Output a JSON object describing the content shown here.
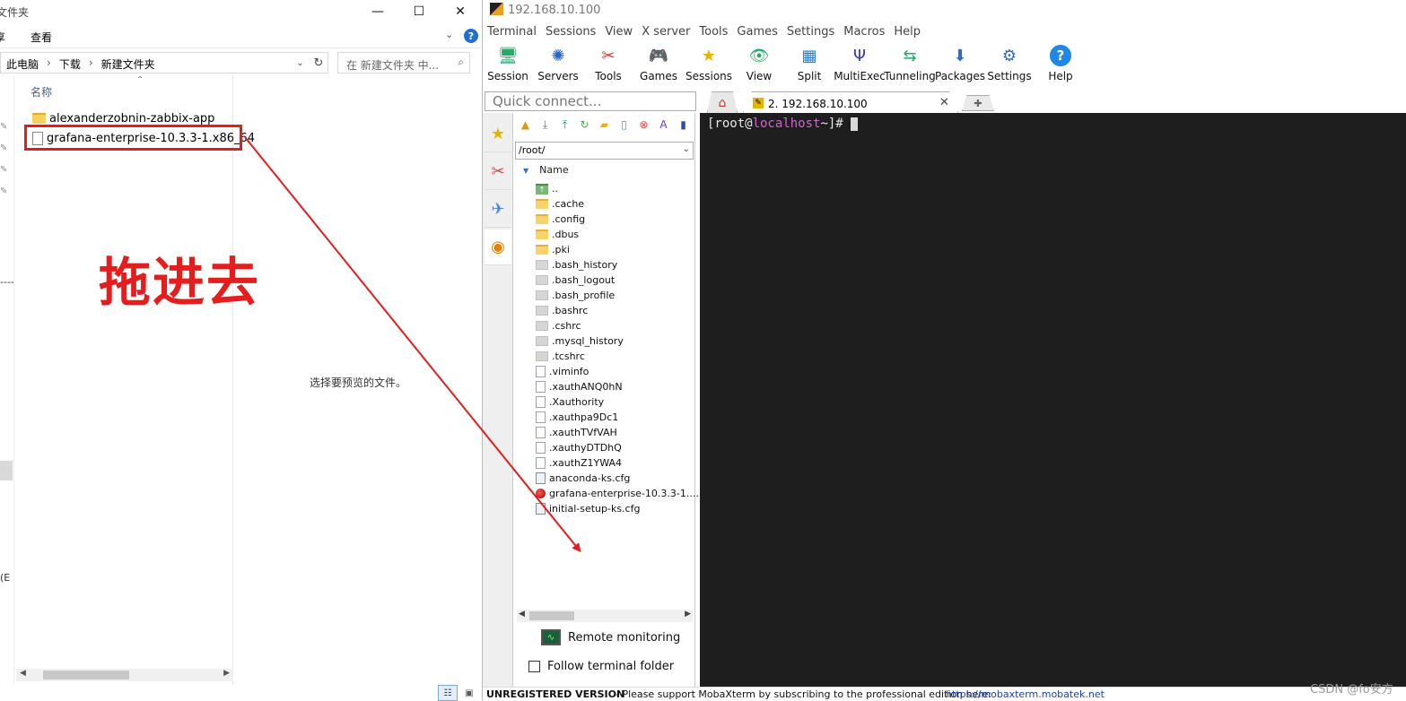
{
  "explorer": {
    "title": "文件夹",
    "ribbon": {
      "menu_1": "享",
      "menu_2": "查看"
    },
    "address": {
      "crumbs": [
        "此电脑",
        "下载",
        "新建文件夹"
      ]
    },
    "search_placeholder": "在 新建文件夹 中...",
    "column_name": "名称",
    "files": [
      {
        "name": "alexanderzobnin-zabbix-app",
        "kind": "folder"
      },
      {
        "name": "grafana-enterprise-10.3.3-1.x86_64",
        "kind": "file"
      }
    ],
    "preview_text": "选择要预览的文件。",
    "side_text": "(E",
    "dash_text": "----"
  },
  "annotation": {
    "drag_label": "拖进去",
    "color": "#e31c1c"
  },
  "moba": {
    "title": "192.168.10.100",
    "menu": [
      "Terminal",
      "Sessions",
      "View",
      "X server",
      "Tools",
      "Games",
      "Settings",
      "Macros",
      "Help"
    ],
    "toolbar": [
      {
        "label": "Session",
        "icon": "session-icon"
      },
      {
        "label": "Servers",
        "icon": "servers-icon"
      },
      {
        "label": "Tools",
        "icon": "tools-icon"
      },
      {
        "label": "Games",
        "icon": "games-icon"
      },
      {
        "label": "Sessions",
        "icon": "sessions-star-icon"
      },
      {
        "label": "View",
        "icon": "view-icon"
      },
      {
        "label": "Split",
        "icon": "split-icon"
      },
      {
        "label": "MultiExec",
        "icon": "multiexec-icon"
      },
      {
        "label": "Tunneling",
        "icon": "tunneling-icon"
      },
      {
        "label": "Packages",
        "icon": "packages-icon"
      },
      {
        "label": "Settings",
        "icon": "settings-icon"
      },
      {
        "label": "Help",
        "icon": "help-icon"
      }
    ],
    "quick_connect_placeholder": "Quick connect...",
    "active_tab": "2. 192.168.10.100",
    "sftp": {
      "path": "/root/",
      "column_name": "Name",
      "rows": [
        {
          "name": "..",
          "kind": "up"
        },
        {
          "name": ".cache",
          "kind": "folder"
        },
        {
          "name": ".config",
          "kind": "folder"
        },
        {
          "name": ".dbus",
          "kind": "folder"
        },
        {
          "name": ".pki",
          "kind": "folder"
        },
        {
          "name": ".bash_history",
          "kind": "hidden"
        },
        {
          "name": ".bash_logout",
          "kind": "hidden"
        },
        {
          "name": ".bash_profile",
          "kind": "hidden"
        },
        {
          "name": ".bashrc",
          "kind": "hidden"
        },
        {
          "name": ".cshrc",
          "kind": "hidden"
        },
        {
          "name": ".mysql_history",
          "kind": "hidden"
        },
        {
          "name": ".tcshrc",
          "kind": "hidden"
        },
        {
          "name": ".viminfo",
          "kind": "file"
        },
        {
          "name": ".xauthANQ0hN",
          "kind": "file"
        },
        {
          "name": ".Xauthority",
          "kind": "file"
        },
        {
          "name": ".xauthpa9Dc1",
          "kind": "file"
        },
        {
          "name": ".xauthTVfVAH",
          "kind": "file"
        },
        {
          "name": ".xauthyDTDhQ",
          "kind": "file"
        },
        {
          "name": ".xauthZ1YWA4",
          "kind": "file"
        },
        {
          "name": "anaconda-ks.cfg",
          "kind": "cfg"
        },
        {
          "name": "grafana-enterprise-10.3.3-1....",
          "kind": "rpm"
        },
        {
          "name": "initial-setup-ks.cfg",
          "kind": "cfg"
        }
      ],
      "remote_monitoring": "Remote monitoring",
      "follow_terminal": "Follow terminal folder"
    },
    "terminal": {
      "prompt_user": "[root@",
      "prompt_host": "localhost",
      "prompt_tail": " ~]#"
    },
    "status": {
      "bold": "UNREGISTERED VERSION",
      "message": " -  Please support MobaXterm by subscribing to the professional edition here:",
      "link": "https://mobaxterm.mobatek.net"
    }
  },
  "watermark": "CSDN @fo安方"
}
